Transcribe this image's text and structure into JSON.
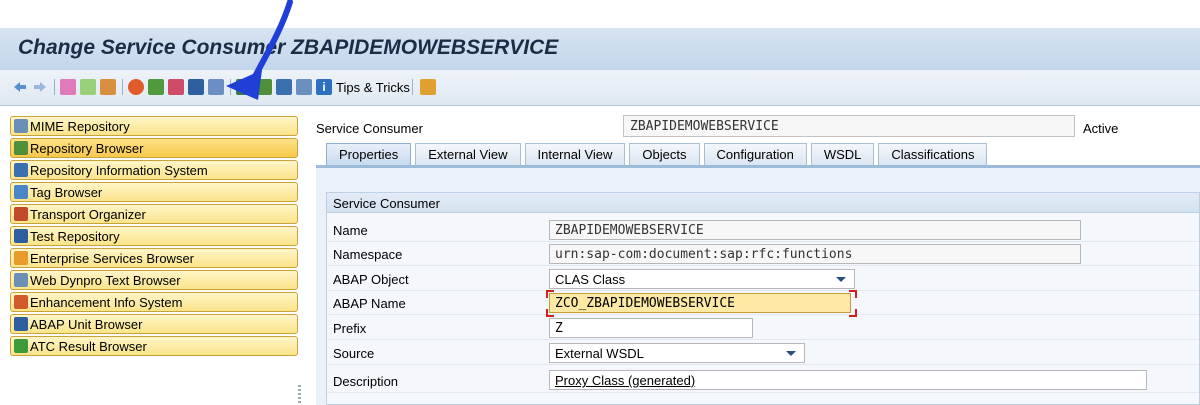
{
  "window": {
    "title": "Change Service Consumer ZBAPIDEMOWEBSERVICE"
  },
  "toolbar": {
    "tips_label": "Tips & Tricks",
    "icons": [
      "back-icon",
      "forward-icon",
      "other-object-icon",
      "display-change-icon",
      "activate-icon",
      "check-icon",
      "where-used-icon",
      "edit-object-icon",
      "test-icon",
      "object-list-icon",
      "navigate-icon",
      "display-object-list-icon",
      "enhance-icon",
      "help-icon",
      "info-icon",
      "tips-icon",
      "settings-icon"
    ]
  },
  "navigation": {
    "items": [
      {
        "label": "MIME Repository",
        "icon": "mime-icon",
        "color": "#6b8fb5"
      },
      {
        "label": "Repository Browser",
        "icon": "repository-icon",
        "color": "#4f8f3a"
      },
      {
        "label": "Repository Information System",
        "icon": "info-system-icon",
        "color": "#3a6fb0"
      },
      {
        "label": "Tag Browser",
        "icon": "tag-icon",
        "color": "#4a86c8"
      },
      {
        "label": "Transport Organizer",
        "icon": "truck-icon",
        "color": "#c04a2a"
      },
      {
        "label": "Test Repository",
        "icon": "test-repo-icon",
        "color": "#2d5fa0"
      },
      {
        "label": "Enterprise Services Browser",
        "icon": "enterprise-icon",
        "color": "#e89a2a"
      },
      {
        "label": "Web Dynpro Text Browser",
        "icon": "web-dynpro-icon",
        "color": "#6b8fb5"
      },
      {
        "label": "Enhancement Info System",
        "icon": "enhancement-icon",
        "color": "#d05a2a"
      },
      {
        "label": "ABAP Unit Browser",
        "icon": "abap-unit-icon",
        "color": "#2d5fa0"
      },
      {
        "label": "ATC Result Browser",
        "icon": "atc-icon",
        "color": "#3c9a3a"
      }
    ],
    "selected_index": 1
  },
  "header": {
    "label": "Service Consumer",
    "value": "ZBAPIDEMOWEBSERVICE",
    "status": "Active"
  },
  "tabs": [
    {
      "label": "Properties",
      "active": true
    },
    {
      "label": "External View"
    },
    {
      "label": "Internal View"
    },
    {
      "label": "Objects"
    },
    {
      "label": "Configuration"
    },
    {
      "label": "WSDL"
    },
    {
      "label": "Classifications"
    }
  ],
  "group": {
    "title": "Service Consumer",
    "fields": {
      "name": {
        "label": "Name",
        "value": "ZBAPIDEMOWEBSERVICE"
      },
      "namespace": {
        "label": "Namespace",
        "value": "urn:sap-com:document:sap:rfc:functions"
      },
      "abap_object": {
        "label": "ABAP Object",
        "value": "CLAS Class"
      },
      "abap_name": {
        "label": "ABAP Name",
        "value": "ZCO_ZBAPIDEMOWEBSERVICE"
      },
      "prefix": {
        "label": "Prefix",
        "value": "Z"
      },
      "source": {
        "label": "Source",
        "value": "External WSDL"
      },
      "description": {
        "label": "Description",
        "value": "Proxy Class (generated)"
      }
    }
  },
  "colors": {
    "annotation_arrow": "#1f3fd6",
    "title_bar": "#c9d9ec",
    "nav_item": "#fbe48a",
    "focus_field": "#fde9a3"
  }
}
